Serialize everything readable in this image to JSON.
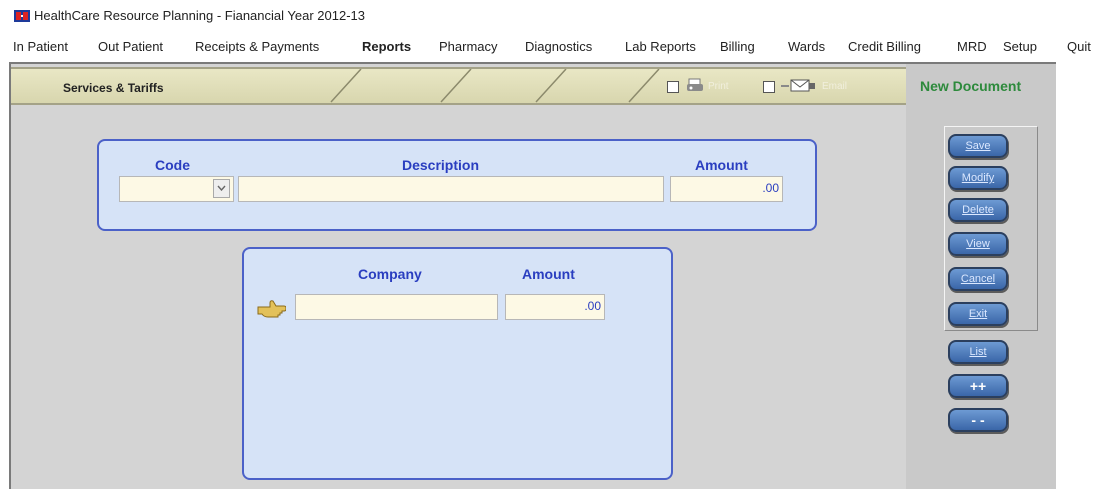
{
  "window": {
    "title": "HealthCare Resource Planning - Fianancial Year 2012-13",
    "icon": "app-logo-icon"
  },
  "menu": {
    "items": [
      {
        "label": "In Patient"
      },
      {
        "label": "Out Patient"
      },
      {
        "label": "Receipts & Payments"
      },
      {
        "label": "Reports",
        "bold": true
      },
      {
        "label": "Pharmacy"
      },
      {
        "label": "Diagnostics"
      },
      {
        "label": "Lab Reports"
      },
      {
        "label": "Billing"
      },
      {
        "label": "Wards"
      },
      {
        "label": "Credit Billing"
      },
      {
        "label": "MRD"
      },
      {
        "label": "Setup"
      },
      {
        "label": "Quit"
      }
    ]
  },
  "header": {
    "title": "Services & Tariffs",
    "print_label": "Print",
    "email_label": "Email"
  },
  "side": {
    "status": "New Document",
    "buttons": [
      "Save",
      "Modify",
      "Delete",
      "View",
      "Cancel",
      "Exit"
    ],
    "list_label": "List",
    "next_label": "++",
    "prev_label": "- -"
  },
  "service_form": {
    "code_label": "Code",
    "description_label": "Description",
    "amount_label": "Amount",
    "code_value": "",
    "description_value": "",
    "amount_value": ".00"
  },
  "company_form": {
    "company_label": "Company",
    "amount_label": "Amount",
    "company_value": "",
    "amount_value": ".00"
  },
  "colors": {
    "accent": "#2a3ec0",
    "status_green": "#2d8a3c",
    "panel_fill": "#d6e3f7",
    "field_fill": "#fdf9e5"
  }
}
